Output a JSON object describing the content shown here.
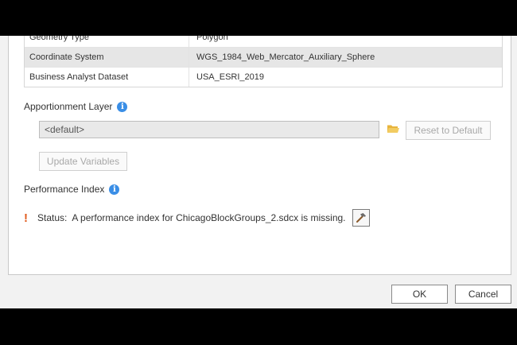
{
  "table": {
    "rows": [
      {
        "key": "Geometry Type",
        "value": "Polygon"
      },
      {
        "key": "Coordinate System",
        "value": "WGS_1984_Web_Mercator_Auxiliary_Sphere"
      },
      {
        "key": "Business Analyst Dataset",
        "value": "USA_ESRI_2019"
      }
    ]
  },
  "apportionment": {
    "label": "Apportionment Layer",
    "value": "<default>",
    "reset_label": "Reset to Default",
    "update_label": "Update Variables"
  },
  "performance": {
    "label": "Performance Index",
    "status_prefix": "Status:",
    "status_text": "A performance index for ChicagoBlockGroups_2.sdcx is missing."
  },
  "footer": {
    "ok_label": "OK",
    "cancel_label": "Cancel"
  },
  "colors": {
    "info": "#3a8ee6",
    "warning": "#e05a1c",
    "folder": "#e8b43c"
  }
}
